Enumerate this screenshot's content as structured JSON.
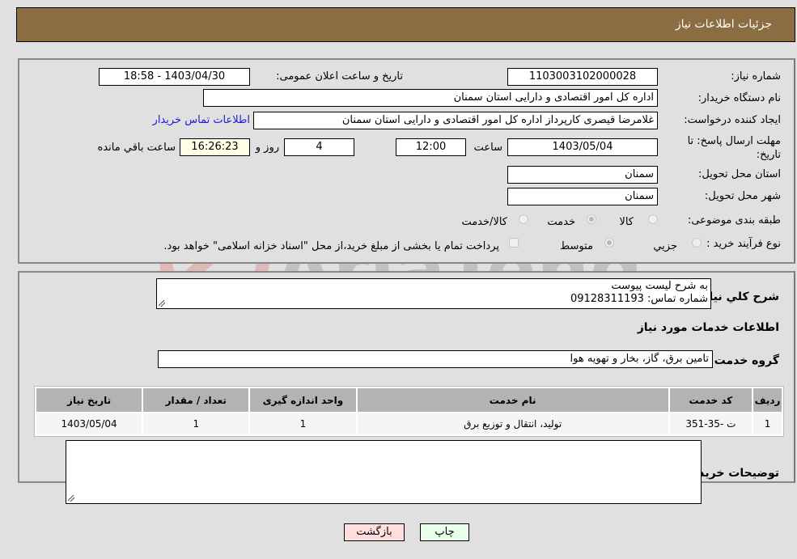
{
  "header": {
    "title": "جزئیات اطلاعات نیاز"
  },
  "form": {
    "need_number": {
      "label": "شماره نیاز:",
      "value": "1103003102000028"
    },
    "announce_datetime": {
      "label": "تاریخ و ساعت اعلان عمومی:",
      "value": "1403/04/30 - 18:58"
    },
    "buyer_org": {
      "label": "نام دستگاه خریدار:",
      "value": "اداره کل امور اقتصادی و دارایی استان سمنان"
    },
    "requester": {
      "label": "ایجاد کننده درخواست:",
      "value": "غلامرضا قیصری کارپرداز اداره کل امور اقتصادی و دارایی استان سمنان"
    },
    "buyer_contact_link": "اطلاعات تماس خریدار",
    "deadline": {
      "label": "مهلت ارسال پاسخ: تا تاریخ:",
      "date": "1403/05/04",
      "time_label": "ساعت",
      "time": "12:00",
      "days": "4",
      "days_label": "روز و",
      "remaining": "16:26:23",
      "remaining_label": "ساعت باقي مانده"
    },
    "delivery_province": {
      "label": "استان محل تحویل:",
      "value": "سمنان"
    },
    "delivery_city": {
      "label": "شهر محل تحویل:",
      "value": "سمنان"
    },
    "category": {
      "label": "طبقه بندی موضوعی:",
      "options": [
        "کالا",
        "خدمت",
        "کالا/خدمت"
      ],
      "selected": "خدمت"
    },
    "purchase_type": {
      "label": "نوع فرآیند خرید :",
      "options": [
        "جزیي",
        "متوسط"
      ],
      "selected": "متوسط",
      "treasury_note": "پرداخت تمام یا بخشی از مبلغ خرید،از محل \"اسناد خزانه اسلامی\" خواهد بود."
    }
  },
  "details": {
    "description_label": "شرح کلي نیاز:",
    "description_lines": [
      "به شرح لیست پیوست",
      "شماره تماس: 09128311193"
    ],
    "services_heading": "اطلاعات خدمات مورد نیاز",
    "service_group_label": "گروه خدمت:",
    "service_group": "تامین برق، گاز، بخار و تهویه هوا",
    "table": {
      "headers": [
        "ردیف",
        "کد خدمت",
        "نام خدمت",
        "واحد اندازه گیری",
        "تعداد / مقدار",
        "تاریخ نیاز"
      ],
      "rows": [
        [
          "1",
          "ت -35-351",
          "تولید، انتقال و توزیع برق",
          "1",
          "1",
          "1403/05/04"
        ]
      ]
    },
    "buyer_notes_label": "توضیحات خریدار:",
    "buyer_notes": ""
  },
  "buttons": {
    "print": "چاپ",
    "back": "بازگشت"
  },
  "colors": {
    "header_bg": "#8b6d42",
    "print_bg": "#eaffea",
    "back_bg": "#ffdede",
    "link": "#1a1adb"
  },
  "watermark": "AriaTender.neT"
}
